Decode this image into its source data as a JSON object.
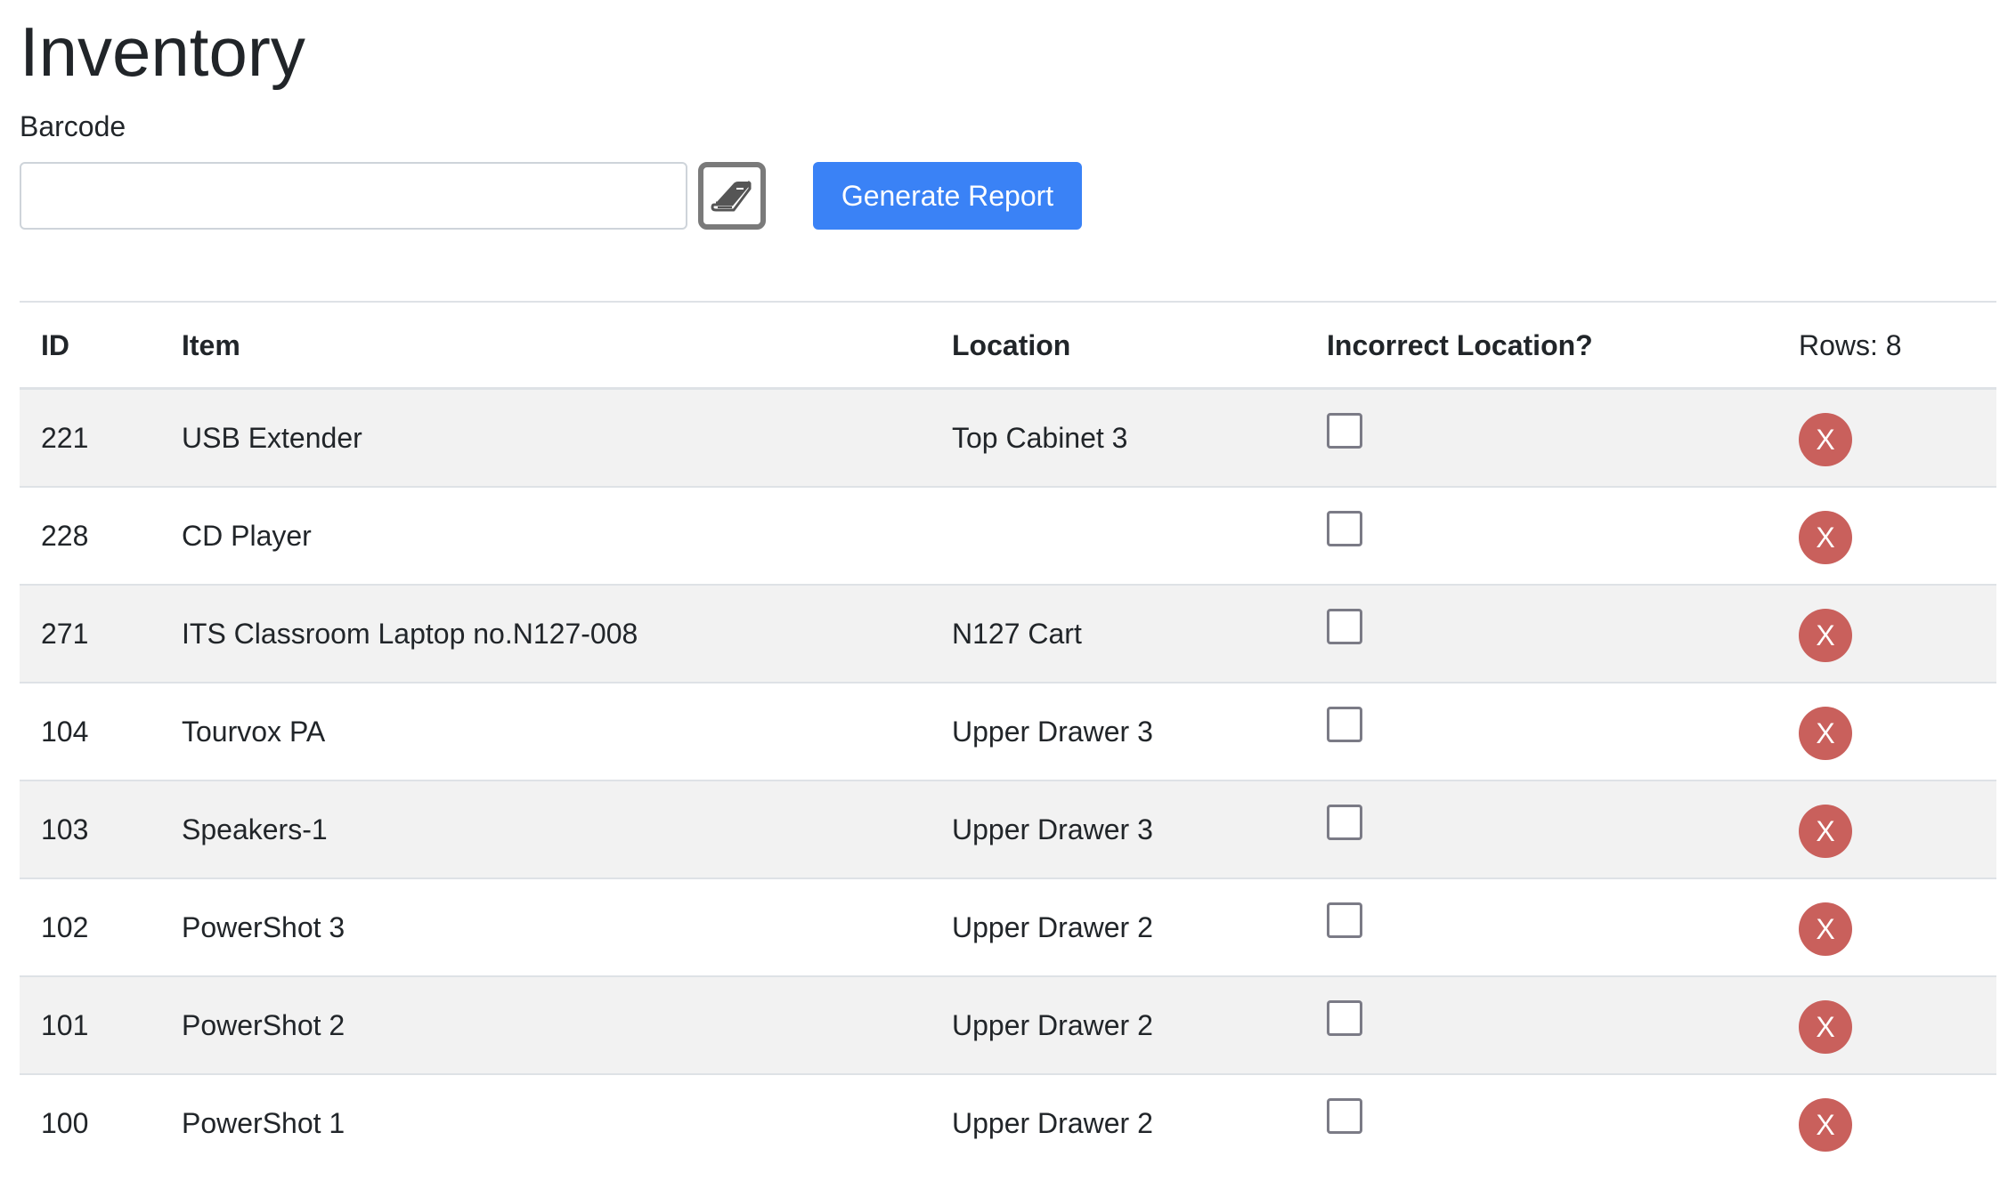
{
  "page": {
    "title": "Inventory"
  },
  "form": {
    "barcode_label": "Barcode",
    "barcode_value": "",
    "barcode_placeholder": "",
    "lookup_icon": "book-icon",
    "generate_label": "Generate Report"
  },
  "colors": {
    "primary": "#3a82f6",
    "danger": "#c9605c",
    "stripe": "#f2f2f2"
  },
  "table": {
    "headers": {
      "id": "ID",
      "item": "Item",
      "location": "Location",
      "incorrect": "Incorrect Location?",
      "rows": "Rows: 8"
    },
    "rows": [
      {
        "id": "221",
        "item": "USB Extender",
        "location": "Top Cabinet 3",
        "incorrect": false,
        "delete": "X"
      },
      {
        "id": "228",
        "item": "CD Player",
        "location": "",
        "incorrect": false,
        "delete": "X"
      },
      {
        "id": "271",
        "item": "ITS Classroom Laptop no.N127-008",
        "location": "N127 Cart",
        "incorrect": false,
        "delete": "X"
      },
      {
        "id": "104",
        "item": "Tourvox PA",
        "location": "Upper Drawer 3",
        "incorrect": false,
        "delete": "X"
      },
      {
        "id": "103",
        "item": "Speakers-1",
        "location": "Upper Drawer 3",
        "incorrect": false,
        "delete": "X"
      },
      {
        "id": "102",
        "item": "PowerShot 3",
        "location": "Upper Drawer 2",
        "incorrect": false,
        "delete": "X"
      },
      {
        "id": "101",
        "item": "PowerShot 2",
        "location": "Upper Drawer 2",
        "incorrect": false,
        "delete": "X"
      },
      {
        "id": "100",
        "item": "PowerShot 1",
        "location": "Upper Drawer 2",
        "incorrect": false,
        "delete": "X"
      }
    ]
  }
}
